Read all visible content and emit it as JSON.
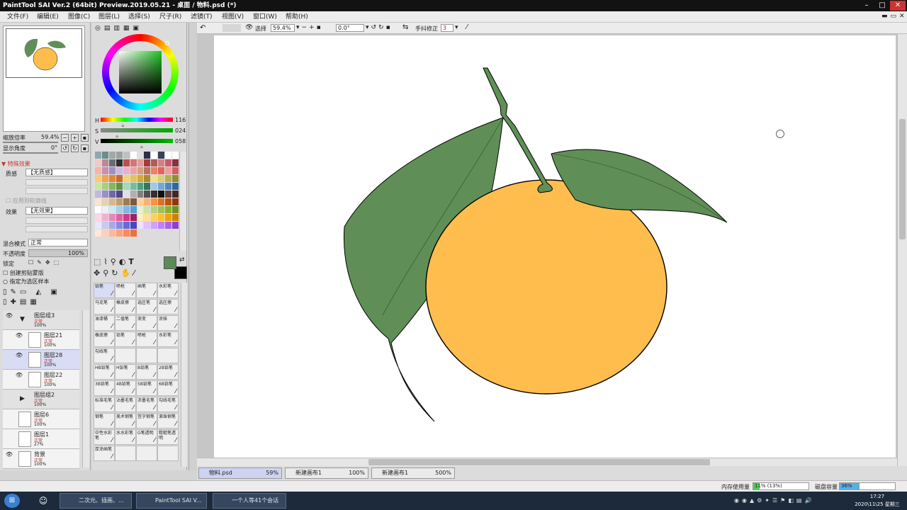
{
  "window": {
    "title": "PaintTool SAI Ver.2 (64bit) Preview.2019.05.21 - 桌面 / 物料.psd (*)",
    "min": "–",
    "max": "□",
    "close": "✕"
  },
  "menu": [
    "文件(F)",
    "编辑(E)",
    "图像(C)",
    "图层(L)",
    "选择(S)",
    "尺子(R)",
    "滤镜(T)",
    "视图(V)",
    "窗口(W)",
    "帮助(H)"
  ],
  "navigator": {
    "zoom_label": "缩放倍率",
    "zoom_value": "59.4%",
    "angle_label": "显示角度",
    "angle_value": "0°"
  },
  "effects": {
    "header": "特殊效果",
    "texture_label": "质感",
    "texture_value": "【无质感】",
    "apply_label": "应用到轮廓线",
    "effect_label": "效果",
    "effect_value": "【无效果】"
  },
  "layer_props": {
    "blend_label": "混合模式",
    "blend_value": "正常",
    "opacity_label": "不透明度",
    "opacity_value": "100%",
    "opacity_fraction": 1.0,
    "lock_label": "锁定",
    "clip_label": "创建剪贴蒙版",
    "sel_label": "指定为选区样本"
  },
  "layers": [
    {
      "name": "图层组3",
      "mode": "正常",
      "opacity": "100%",
      "indent": 0,
      "group": true,
      "visible": true
    },
    {
      "name": "图层21",
      "mode": "正常",
      "opacity": "100%",
      "indent": 1,
      "visible": true
    },
    {
      "name": "图层28",
      "mode": "正常",
      "opacity": "100%",
      "indent": 1,
      "visible": true,
      "selected": true
    },
    {
      "name": "图层22",
      "mode": "正常",
      "opacity": "100%",
      "indent": 1,
      "visible": true
    },
    {
      "name": "图层组2",
      "mode": "正常",
      "opacity": "100%",
      "indent": 0,
      "group": true,
      "visible": false
    },
    {
      "name": "图层6",
      "mode": "正常",
      "opacity": "100%",
      "indent": 0,
      "visible": false
    },
    {
      "name": "图层1",
      "mode": "正常",
      "opacity": "27%",
      "indent": 0,
      "visible": false
    },
    {
      "name": "背景",
      "mode": "正常",
      "opacity": "100%",
      "indent": 0,
      "visible": true
    }
  ],
  "hsv": {
    "h_label": "H",
    "h": "116",
    "s_label": "S",
    "s": "024",
    "v_label": "V",
    "v": "058",
    "h_fraction": 0.32,
    "s_fraction": 0.24,
    "v_fraction": 0.58
  },
  "colors": {
    "foreground": "#5b8c56",
    "background": "#000000",
    "orange": "#ffbd4e",
    "leaf": "#5f8f56",
    "stem": "#5f8f56"
  },
  "tools": [
    {
      "label": "铅笔",
      "selected": true
    },
    {
      "label": "喷枪"
    },
    {
      "label": "画笔"
    },
    {
      "label": "水彩笔"
    },
    {
      "label": "马克笔"
    },
    {
      "label": "橡皮擦"
    },
    {
      "label": "选区笔"
    },
    {
      "label": "选区擦"
    },
    {
      "label": "油漆桶"
    },
    {
      "label": "二值笔"
    },
    {
      "label": "渐变"
    },
    {
      "label": "涂抹"
    },
    {
      "label": "橡皮擦"
    },
    {
      "label": "铅笔"
    },
    {
      "label": "喷枪"
    },
    {
      "label": "水彩笔"
    },
    {
      "label": "勾线笔"
    },
    {
      "label": ""
    },
    {
      "label": ""
    },
    {
      "label": ""
    },
    {
      "label": "HB铅笔"
    },
    {
      "label": "H铅笔"
    },
    {
      "label": "B铅笔"
    },
    {
      "label": "2B铅笔"
    },
    {
      "label": "3B铅笔"
    },
    {
      "label": "4B铅笔"
    },
    {
      "label": "5B铅笔"
    },
    {
      "label": "6B铅笔"
    },
    {
      "label": "标准毛笔"
    },
    {
      "label": "沾墨毛笔"
    },
    {
      "label": "浓墨毛笔"
    },
    {
      "label": "勾线毛笔"
    },
    {
      "label": "钢笔"
    },
    {
      "label": "美术钢笔"
    },
    {
      "label": "签字钢笔"
    },
    {
      "label": "滚珠钢笔"
    },
    {
      "label": "中性水彩笔"
    },
    {
      "label": "水水彩笔"
    },
    {
      "label": "G笔透明"
    },
    {
      "label": "粗糙笔透明"
    },
    {
      "label": "厚涂画笔"
    },
    {
      "label": ""
    },
    {
      "label": ""
    },
    {
      "label": ""
    }
  ],
  "toolbar": {
    "select_label": "选择",
    "zoom": "59.4%",
    "angle": "0.0°",
    "stab_label": "手抖修正",
    "stab_value": "3"
  },
  "tabs": [
    {
      "name": "物料.psd",
      "zoom": "59%",
      "active": true
    },
    {
      "name": "新建画布1",
      "zoom": "100%"
    },
    {
      "name": "新建画布1",
      "zoom": "500%"
    }
  ],
  "status": {
    "mem_label": "内存使用量",
    "mem_value": "11% (13%)",
    "mem_fraction": 0.11,
    "disk_label": "磁盘容量",
    "disk_value": "36%",
    "disk_fraction": 0.36
  },
  "taskbar": {
    "items": [
      "二次元、插画、...",
      "PaintTool SAI V...",
      "一个人等41个会话"
    ],
    "time": "17:27",
    "date": "2020\\11\\25 星期三"
  }
}
